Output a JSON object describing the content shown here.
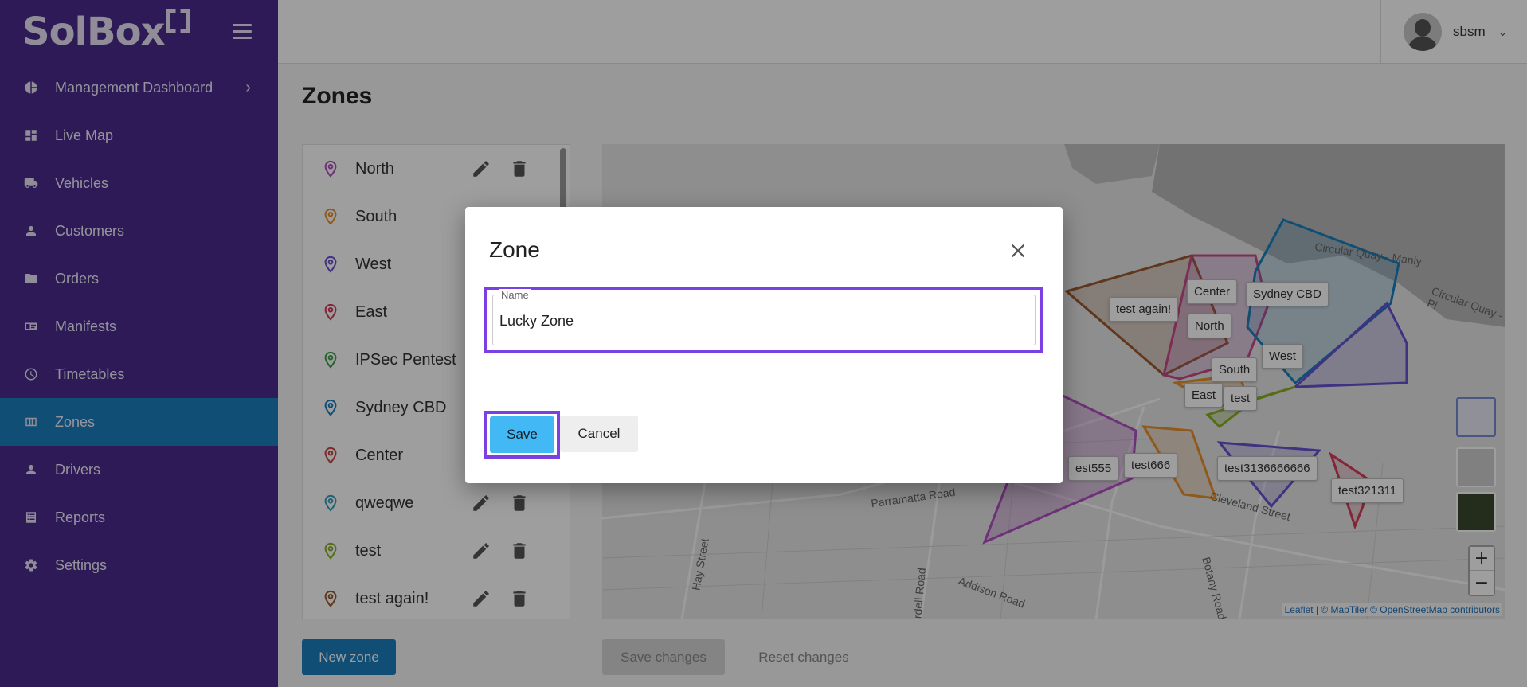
{
  "brand": {
    "name": "SolBox"
  },
  "sidebar": {
    "items": [
      {
        "label": "Management Dashboard",
        "icon": "pie-chart-icon",
        "has_chevron": true
      },
      {
        "label": "Live Map",
        "icon": "dashboard-icon"
      },
      {
        "label": "Vehicles",
        "icon": "truck-icon"
      },
      {
        "label": "Customers",
        "icon": "person-icon"
      },
      {
        "label": "Orders",
        "icon": "folder-icon"
      },
      {
        "label": "Manifests",
        "icon": "id-card-icon"
      },
      {
        "label": "Timetables",
        "icon": "clock-icon"
      },
      {
        "label": "Zones",
        "icon": "map-icon",
        "active": true
      },
      {
        "label": "Drivers",
        "icon": "person-icon"
      },
      {
        "label": "Reports",
        "icon": "list-icon"
      },
      {
        "label": "Settings",
        "icon": "gear-icon"
      }
    ],
    "chevron": "›"
  },
  "topbar": {
    "user_name": "sbsm",
    "chevron": "⌄"
  },
  "page": {
    "title": "Zones"
  },
  "zones": [
    {
      "name": "North",
      "color": "#b04fc0"
    },
    {
      "name": "South",
      "color": "#e8902e"
    },
    {
      "name": "West",
      "color": "#6a4fd0"
    },
    {
      "name": "East",
      "color": "#d43a5a"
    },
    {
      "name": "IPSec Pentest",
      "color": "#3fa04a"
    },
    {
      "name": "Sydney CBD",
      "color": "#1a7fbf"
    },
    {
      "name": "Center",
      "color": "#c9473f"
    },
    {
      "name": "qweqwe",
      "color": "#3a9bbf"
    },
    {
      "name": "test",
      "color": "#8ab026"
    },
    {
      "name": "test again!",
      "color": "#9a5a2e"
    }
  ],
  "buttons": {
    "new_zone": "New zone",
    "save_changes": "Save changes",
    "reset_changes": "Reset changes"
  },
  "map": {
    "labels": [
      "test again!",
      "Center",
      "Sydney CBD",
      "North",
      "South",
      "West",
      "East",
      "test",
      "est555",
      "test666",
      "test3136666666",
      "test321311"
    ],
    "street_names": [
      "Circular Quay - Manly",
      "Circular Quay - Pi",
      "Parramatta Road",
      "Cleveland Street",
      "Hay Street",
      "Addison Road",
      "Botany Road",
      "ardell Road"
    ],
    "zoom_in": "+",
    "zoom_out": "−",
    "attribution_leaflet": "Leaflet",
    "attribution_rest": " | © MapTiler © OpenStreetMap contributors"
  },
  "dialog": {
    "title": "Zone",
    "field_label": "Name",
    "field_value": "Lucky Zone",
    "save_label": "Save",
    "cancel_label": "Cancel"
  }
}
